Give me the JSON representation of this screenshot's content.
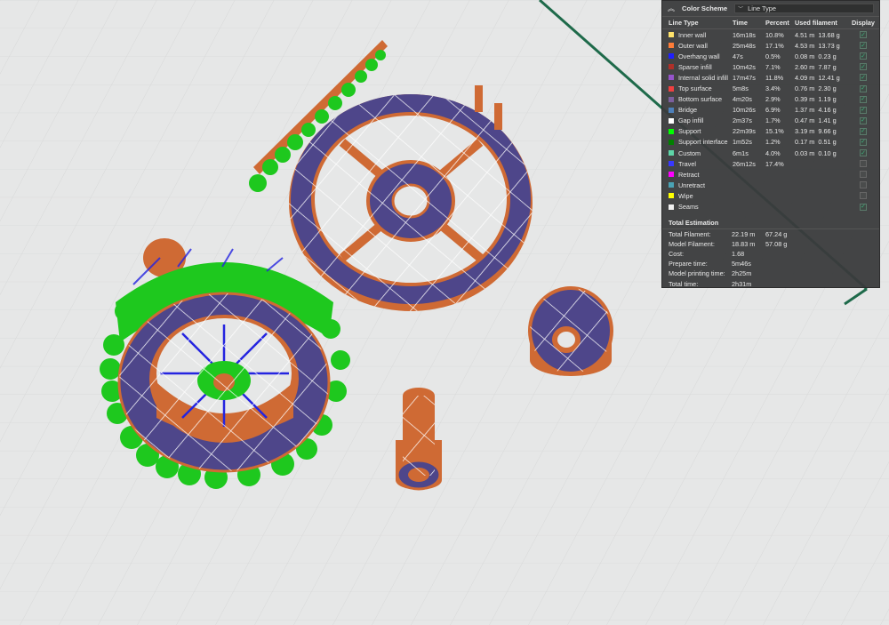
{
  "legend": {
    "scheme_label": "Color Scheme",
    "scheme_value": "Line Type",
    "columns": {
      "type": "Line Type",
      "time": "Time",
      "percent": "Percent",
      "filament": "Used filament",
      "display": "Display"
    },
    "rows": [
      {
        "name": "Inner wall",
        "time": "16m18s",
        "percent": "10.8%",
        "length": "4.51 m",
        "weight": "13.68 g",
        "color": "#ffe36b",
        "display": true
      },
      {
        "name": "Outer wall",
        "time": "25m48s",
        "percent": "17.1%",
        "length": "4.53 m",
        "weight": "13.73 g",
        "color": "#ff7d38",
        "display": true
      },
      {
        "name": "Overhang wall",
        "time": "47s",
        "percent": "0.5%",
        "length": "0.08 m",
        "weight": "0.23 g",
        "color": "#1f1fff",
        "display": true
      },
      {
        "name": "Sparse infill",
        "time": "10m42s",
        "percent": "7.1%",
        "length": "2.60 m",
        "weight": "7.87 g",
        "color": "#b03029",
        "display": true
      },
      {
        "name": "Internal solid infill",
        "time": "17m47s",
        "percent": "11.8%",
        "length": "4.09 m",
        "weight": "12.41 g",
        "color": "#9654cc",
        "display": true
      },
      {
        "name": "Top surface",
        "time": "5m8s",
        "percent": "3.4%",
        "length": "0.76 m",
        "weight": "2.30 g",
        "color": "#f04040",
        "display": true
      },
      {
        "name": "Bottom surface",
        "time": "4m20s",
        "percent": "2.9%",
        "length": "0.39 m",
        "weight": "1.19 g",
        "color": "#7b5f9e",
        "display": true
      },
      {
        "name": "Bridge",
        "time": "10m26s",
        "percent": "6.9%",
        "length": "1.37 m",
        "weight": "4.16 g",
        "color": "#4d80ba",
        "display": true
      },
      {
        "name": "Gap infill",
        "time": "2m37s",
        "percent": "1.7%",
        "length": "0.47 m",
        "weight": "1.41 g",
        "color": "#ffffff",
        "display": true
      },
      {
        "name": "Support",
        "time": "22m39s",
        "percent": "15.1%",
        "length": "3.19 m",
        "weight": "9.66 g",
        "color": "#00ff00",
        "display": true
      },
      {
        "name": "Support interface",
        "time": "1m52s",
        "percent": "1.2%",
        "length": "0.17 m",
        "weight": "0.51 g",
        "color": "#008000",
        "display": true
      },
      {
        "name": "Custom",
        "time": "6m1s",
        "percent": "4.0%",
        "length": "0.03 m",
        "weight": "0.10 g",
        "color": "#5ed6a8",
        "display": true
      },
      {
        "name": "Travel",
        "time": "26m12s",
        "percent": "17.4%",
        "length": "",
        "weight": "",
        "color": "#3838ff",
        "display": false
      },
      {
        "name": "Retract",
        "time": "",
        "percent": "",
        "length": "",
        "weight": "",
        "color": "#ff00ff",
        "display": false
      },
      {
        "name": "Unretract",
        "time": "",
        "percent": "",
        "length": "",
        "weight": "",
        "color": "#4aa3b5",
        "display": false
      },
      {
        "name": "Wipe",
        "time": "",
        "percent": "",
        "length": "",
        "weight": "",
        "color": "#ffff00",
        "display": false
      },
      {
        "name": "Seams",
        "time": "",
        "percent": "",
        "length": "",
        "weight": "",
        "color": "#f0f0f0",
        "display": true
      }
    ],
    "total_title": "Total Estimation",
    "totals": [
      {
        "label": "Total Filament:",
        "v1": "22.19 m",
        "v2": "67.24 g"
      },
      {
        "label": "Model Filament:",
        "v1": "18.83 m",
        "v2": "57.08 g"
      },
      {
        "label": "Cost:",
        "v1": "1.68",
        "v2": ""
      },
      {
        "label": "Prepare time:",
        "v1": "5m46s",
        "v2": ""
      },
      {
        "label": "Model printing time:",
        "v1": "2h25m",
        "v2": ""
      },
      {
        "label": "Total time:",
        "v1": "2h31m",
        "v2": ""
      }
    ]
  },
  "colors": {
    "background": "#e6e7e7",
    "outer_wall": "#cf6a34",
    "solid_infill": "#4e468a",
    "support": "#1ec81e",
    "overhang": "#2424e0",
    "travel_line": "#1e6a4a"
  }
}
